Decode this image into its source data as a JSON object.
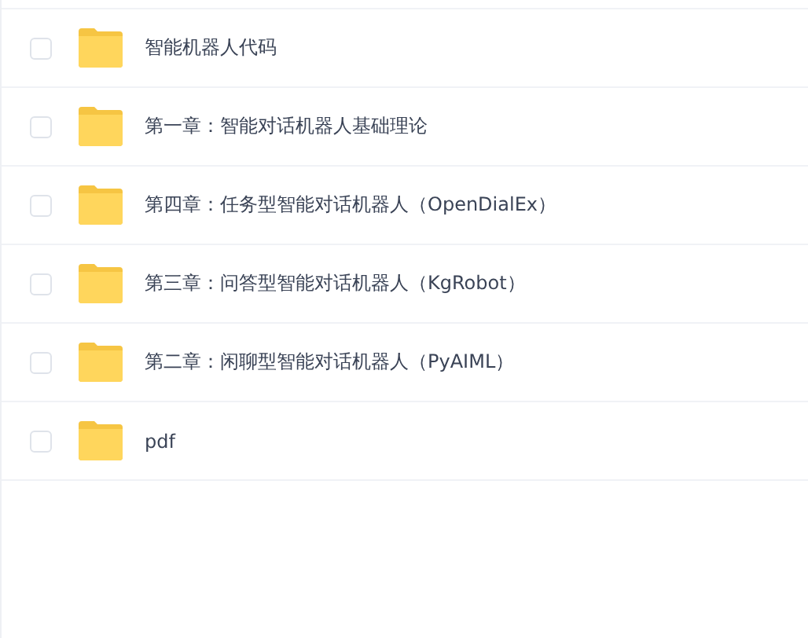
{
  "files": [
    {
      "name": "智能机器人代码",
      "checked": false
    },
    {
      "name": "第一章：智能对话机器人基础理论",
      "checked": false
    },
    {
      "name": "第四章：任务型智能对话机器人（OpenDialEx）",
      "checked": false
    },
    {
      "name": "第三章：问答型智能对话机器人（KgRobot）",
      "checked": false
    },
    {
      "name": "第二章：闲聊型智能对话机器人（PyAIML）",
      "checked": false
    },
    {
      "name": "pdf",
      "checked": false
    }
  ]
}
